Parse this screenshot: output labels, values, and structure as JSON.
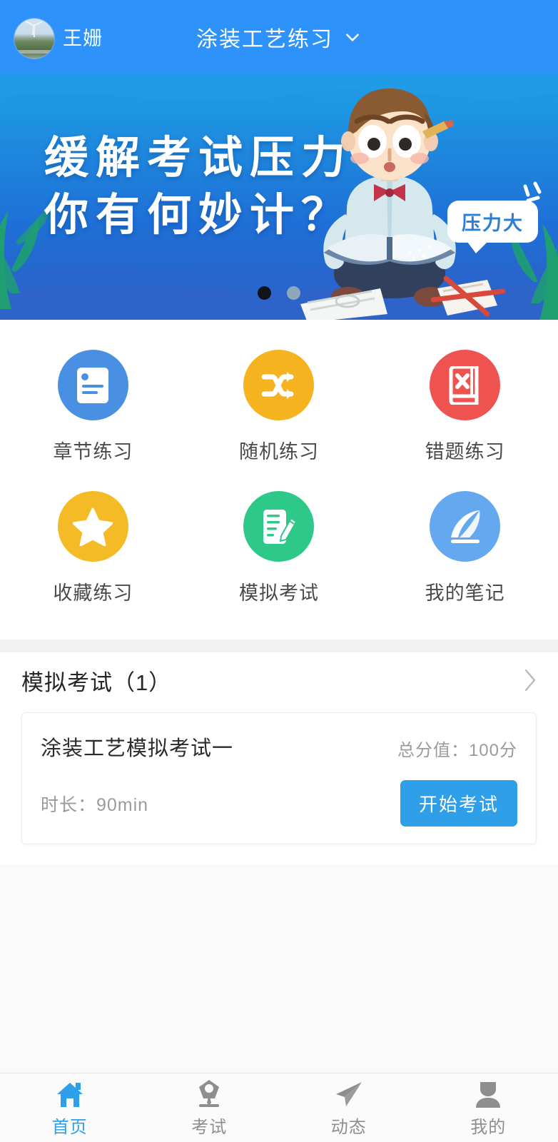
{
  "header": {
    "username": "王姗",
    "title": "涂装工艺练习",
    "dropdown_icon": "chevron-down-icon",
    "avatar_icon": "user-avatar-photo",
    "background_color": "#2d93fb"
  },
  "banner": {
    "headline_line1": "缓解考试压力",
    "headline_line2": "你有何妙计？",
    "bubble_text": "压力大",
    "dots_total": 2,
    "active_dot_index": 0,
    "illustration": "student-reading-book"
  },
  "grid": {
    "items": [
      {
        "label": "章节练习",
        "icon": "document-lines-icon",
        "color": "#4a90e2"
      },
      {
        "label": "随机练习",
        "icon": "shuffle-icon",
        "color": "#f5b320"
      },
      {
        "label": "错题练习",
        "icon": "book-x-icon",
        "color": "#ef5350"
      },
      {
        "label": "收藏练习",
        "icon": "star-icon",
        "color": "#f5bb26"
      },
      {
        "label": "模拟考试",
        "icon": "document-pencil-icon",
        "color": "#2ec98a"
      },
      {
        "label": "我的笔记",
        "icon": "feather-quill-icon",
        "color": "#64a8f0"
      }
    ]
  },
  "exam_section": {
    "title": "模拟考试（1）",
    "more_icon": "chevron-right-icon",
    "card": {
      "name": "涂装工艺模拟考试一",
      "score_label": "总分值：100分",
      "duration_label": "时长：90min",
      "start_button": "开始考试",
      "button_color": "#2e9fe8"
    }
  },
  "tabbar": {
    "active_index": 0,
    "active_color": "#2e9fe8",
    "inactive_color": "#8e8e8e",
    "items": [
      {
        "label": "首页",
        "icon": "home-icon"
      },
      {
        "label": "考试",
        "icon": "pen-nib-icon"
      },
      {
        "label": "动态",
        "icon": "paper-plane-icon"
      },
      {
        "label": "我的",
        "icon": "person-icon"
      }
    ]
  }
}
